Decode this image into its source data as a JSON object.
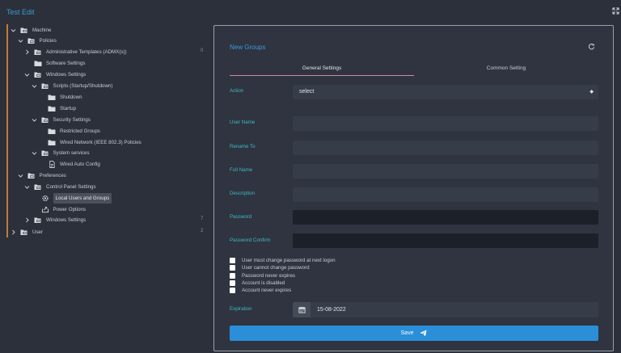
{
  "app": {
    "title": "Test Edit"
  },
  "tree": {
    "items": [
      {
        "label": "Machine",
        "chevron": "down",
        "icon": "folder-tree-icon",
        "indent": 0
      },
      {
        "label": "Policies",
        "chevron": "down",
        "icon": "folder-tree-icon",
        "indent": 1
      },
      {
        "label": "Administrative Templates (ADMX(s))",
        "chevron": "right",
        "icon": "folder-tree-icon",
        "indent": 2,
        "badge": "0"
      },
      {
        "label": "Software Settings",
        "chevron": "",
        "icon": "folder-icon",
        "indent": 2
      },
      {
        "label": "Windows Settings",
        "chevron": "down",
        "icon": "folder-tree-icon",
        "indent": 2
      },
      {
        "label": "Scripts (Startup/Shutdown)",
        "chevron": "down",
        "icon": "folder-tree-icon",
        "indent": 3
      },
      {
        "label": "Shutdown",
        "chevron": "",
        "icon": "folder-icon",
        "indent": 4
      },
      {
        "label": "Startup",
        "chevron": "",
        "icon": "folder-icon",
        "indent": 4
      },
      {
        "label": "Security Settings",
        "chevron": "down",
        "icon": "folder-tree-icon",
        "indent": 3
      },
      {
        "label": "Restricted Groups",
        "chevron": "",
        "icon": "folder-icon",
        "indent": 4
      },
      {
        "label": "Wired Network (IEEE 802.3) Policies",
        "chevron": "",
        "icon": "folder-icon",
        "indent": 4
      },
      {
        "label": "System services",
        "chevron": "down",
        "icon": "folder-tree-icon",
        "indent": 3
      },
      {
        "label": "Wired Auto Config",
        "chevron": "",
        "icon": "file-icon",
        "indent": 4
      },
      {
        "label": "Preferences",
        "chevron": "down",
        "icon": "folder-tree-icon",
        "indent": 1
      },
      {
        "label": "Control Panel Settings",
        "chevron": "down",
        "icon": "folder-tree-icon",
        "indent": 2
      },
      {
        "label": "Local Users and Groups",
        "chevron": "",
        "icon": "users-gear-icon",
        "indent": 3,
        "selected": true
      },
      {
        "label": "Power Options",
        "chevron": "",
        "icon": "power-options-icon",
        "indent": 3
      },
      {
        "label": "Windows Settings",
        "chevron": "right",
        "icon": "folder-tree-icon",
        "indent": 2,
        "badge": "7"
      },
      {
        "label": "User",
        "chevron": "right",
        "icon": "folder-tree-icon",
        "indent": 0,
        "badge": "2"
      }
    ]
  },
  "form": {
    "title": "New Groups",
    "tabs": {
      "general": "General Settings",
      "common": "Common Setting"
    },
    "fields": {
      "action": {
        "label": "Action",
        "value": "select"
      },
      "user_name": {
        "label": "User Name",
        "value": ""
      },
      "rename_to": {
        "label": "Rename To",
        "value": ""
      },
      "full_name": {
        "label": "Full Name",
        "value": ""
      },
      "description": {
        "label": "Description",
        "value": ""
      },
      "password": {
        "label": "Password",
        "value": ""
      },
      "password_confirm": {
        "label": "Password Confirm",
        "value": ""
      }
    },
    "checkboxes": [
      {
        "label": "User must change password at next logon",
        "checked": false
      },
      {
        "label": "User cannot change password",
        "checked": false
      },
      {
        "label": "Password never expires",
        "checked": false
      },
      {
        "label": "Account is disabled",
        "checked": false
      },
      {
        "label": "Account never expires",
        "checked": false
      }
    ],
    "expiration": {
      "label": "Expiration",
      "value": "15-08-2022"
    },
    "save_label": "Save"
  },
  "colors": {
    "accent": "#3d9ad6",
    "label_teal": "#3fb9c0",
    "save_button": "#2a8fd8",
    "tree_rail": "#c47a3a",
    "tab_underline": "#d08aa0"
  }
}
